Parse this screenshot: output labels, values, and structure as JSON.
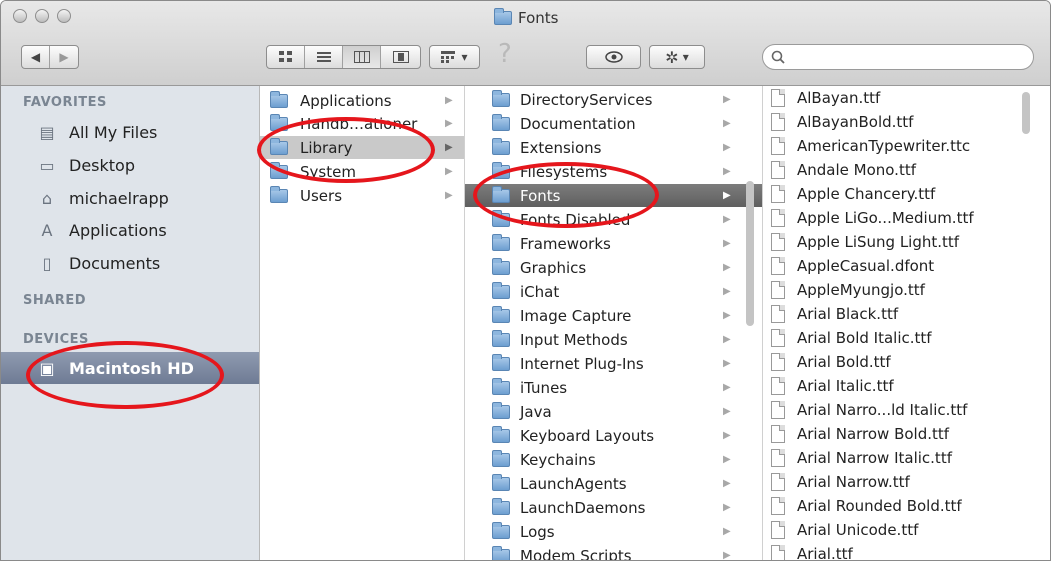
{
  "window": {
    "title": "Fonts"
  },
  "toolbar": {
    "help_glyph": "?",
    "search_placeholder": ""
  },
  "sidebar": {
    "favorites_header": "FAVORITES",
    "shared_header": "SHARED",
    "devices_header": "DEVICES",
    "favorites": [
      {
        "label": "All My Files",
        "icon": "all-files-icon"
      },
      {
        "label": "Desktop",
        "icon": "desktop-icon"
      },
      {
        "label": "michaelrapp",
        "icon": "home-icon"
      },
      {
        "label": "Applications",
        "icon": "applications-icon"
      },
      {
        "label": "Documents",
        "icon": "documents-icon"
      }
    ],
    "devices": [
      {
        "label": "Macintosh HD",
        "icon": "hard-drive-icon",
        "selected": true
      }
    ]
  },
  "columns": {
    "col1": [
      {
        "name": "Applications",
        "folder": true
      },
      {
        "name": "Handb…ationer",
        "folder": true
      },
      {
        "name": "Library",
        "folder": true,
        "selected": true
      },
      {
        "name": "System",
        "folder": true
      },
      {
        "name": "Users",
        "folder": true
      }
    ],
    "col2": [
      "DirectoryServices",
      "Documentation",
      "Extensions",
      "Filesystems",
      "Fonts",
      "Fonts Disabled",
      "Frameworks",
      "Graphics",
      "iChat",
      "Image Capture",
      "Input Methods",
      "Internet Plug-Ins",
      "iTunes",
      "Java",
      "Keyboard Layouts",
      "Keychains",
      "LaunchAgents",
      "LaunchDaemons",
      "Logs",
      "Modem Scripts"
    ],
    "col2_selected": "Fonts",
    "col3": [
      "AlBayan.ttf",
      "AlBayanBold.ttf",
      "AmericanTypewriter.ttc",
      "Andale Mono.ttf",
      "Apple Chancery.ttf",
      "Apple LiGo...Medium.ttf",
      "Apple LiSung Light.ttf",
      "AppleCasual.dfont",
      "AppleMyungjo.ttf",
      "Arial Black.ttf",
      "Arial Bold Italic.ttf",
      "Arial Bold.ttf",
      "Arial Italic.ttf",
      "Arial Narro...ld Italic.ttf",
      "Arial Narrow Bold.ttf",
      "Arial Narrow Italic.ttf",
      "Arial Narrow.ttf",
      "Arial Rounded Bold.ttf",
      "Arial Unicode.ttf",
      "Arial.ttf"
    ]
  },
  "colors": {
    "annotation": "#e5161c",
    "sidebar_bg": "#dfe4ea",
    "selection": "#6e7b94"
  }
}
